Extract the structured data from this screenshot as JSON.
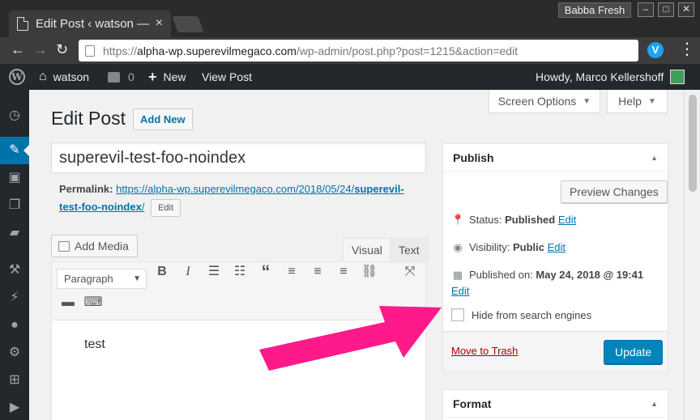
{
  "browser": {
    "tab_title": "Edit Post ‹ watson —",
    "tab_close": "×",
    "profile_name": "Babba Fresh",
    "minimize": "–",
    "maximize": "□",
    "close": "✕",
    "back": "←",
    "forward": "→",
    "reload": "↻",
    "url_scheme": "https://",
    "url_host": "alpha-wp.superevilmegaco.com",
    "url_path": "/wp-admin/post.php?post=1215&action=edit",
    "extension_letter": "V",
    "menu": "⋮"
  },
  "adminbar": {
    "site_name": "watson",
    "comments_count": "0",
    "new_label": "New",
    "view_post": "View Post",
    "howdy": "Howdy, Marco Kellershoff"
  },
  "sidebar": {
    "icons": [
      "dashboard-icon",
      "posts-icon",
      "media-icon",
      "pages-icon",
      "comments-icon",
      "appearance-icon",
      "plugins-icon",
      "users-icon",
      "tools-icon",
      "settings-icon",
      "collapse-icon"
    ]
  },
  "screen_meta": {
    "screen_options": "Screen Options",
    "help": "Help"
  },
  "header": {
    "title": "Edit Post",
    "add_new": "Add New"
  },
  "post": {
    "title": "superevil-test-foo-noindex",
    "permalink_label": "Permalink:",
    "permalink_base": "https://alpha-wp.superevilmegaco.com/2018/05/24/",
    "permalink_slug": "superevil-test-foo-noindex",
    "permalink_end": "/",
    "edit_slug": "Edit"
  },
  "editor": {
    "add_media": "Add Media",
    "tab_visual": "Visual",
    "tab_text": "Text",
    "format_select": "Paragraph",
    "content": "test"
  },
  "publish": {
    "heading": "Publish",
    "preview": "Preview Changes",
    "status_label": "Status:",
    "status_value": "Published",
    "visibility_label": "Visibility:",
    "visibility_value": "Public",
    "published_label": "Published on:",
    "published_value": "May 24, 2018 @ 19:41",
    "edit": "Edit",
    "hide_search": "Hide from search engines",
    "trash": "Move to Trash",
    "update": "Update"
  },
  "format_box": {
    "heading": "Format"
  },
  "colors": {
    "wp_blue": "#0073aa",
    "update_button": "#0085ba",
    "arrow": "#ff1a8c"
  }
}
